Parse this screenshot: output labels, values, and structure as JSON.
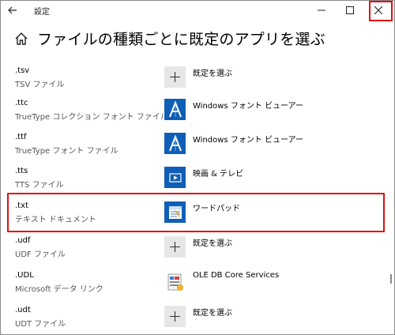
{
  "window": {
    "title": "設定",
    "back_icon": "back-arrow-icon",
    "minimize_glyph": "—",
    "maximize_glyph": "☐",
    "close_glyph": "✕",
    "highlight_color": "#e01010"
  },
  "page": {
    "title": "ファイルの種類ごとに既定のアプリを選ぶ",
    "home_icon": "home-icon"
  },
  "rows": [
    {
      "ext": ".tsv",
      "desc": "TSV ファイル",
      "app": "既定を選ぶ",
      "icon": "plus-icon"
    },
    {
      "ext": ".ttc",
      "desc": "TrueType コレクション フォント ファイル",
      "app": "Windows フォント ビューアー",
      "icon": "font-viewer-icon"
    },
    {
      "ext": ".ttf",
      "desc": "TrueType フォント ファイル",
      "app": "Windows フォント ビューアー",
      "icon": "font-viewer-icon"
    },
    {
      "ext": ".tts",
      "desc": "TTS ファイル",
      "app": "映画 & テレビ",
      "icon": "movies-tv-icon"
    },
    {
      "ext": ".txt",
      "desc": "テキスト ドキュメント",
      "app": "ワードパッド",
      "icon": "wordpad-icon"
    },
    {
      "ext": ".udf",
      "desc": "UDF ファイル",
      "app": "既定を選ぶ",
      "icon": "plus-icon"
    },
    {
      "ext": ".UDL",
      "desc": "Microsoft データ リンク",
      "app": "OLE DB Core Services",
      "icon": "ole-db-icon"
    },
    {
      "ext": ".udt",
      "desc": "UDT ファイル",
      "app": "既定を選ぶ",
      "icon": "plus-icon"
    }
  ],
  "highlighted_row": ".txt",
  "accent_color": "#0f5fb6"
}
